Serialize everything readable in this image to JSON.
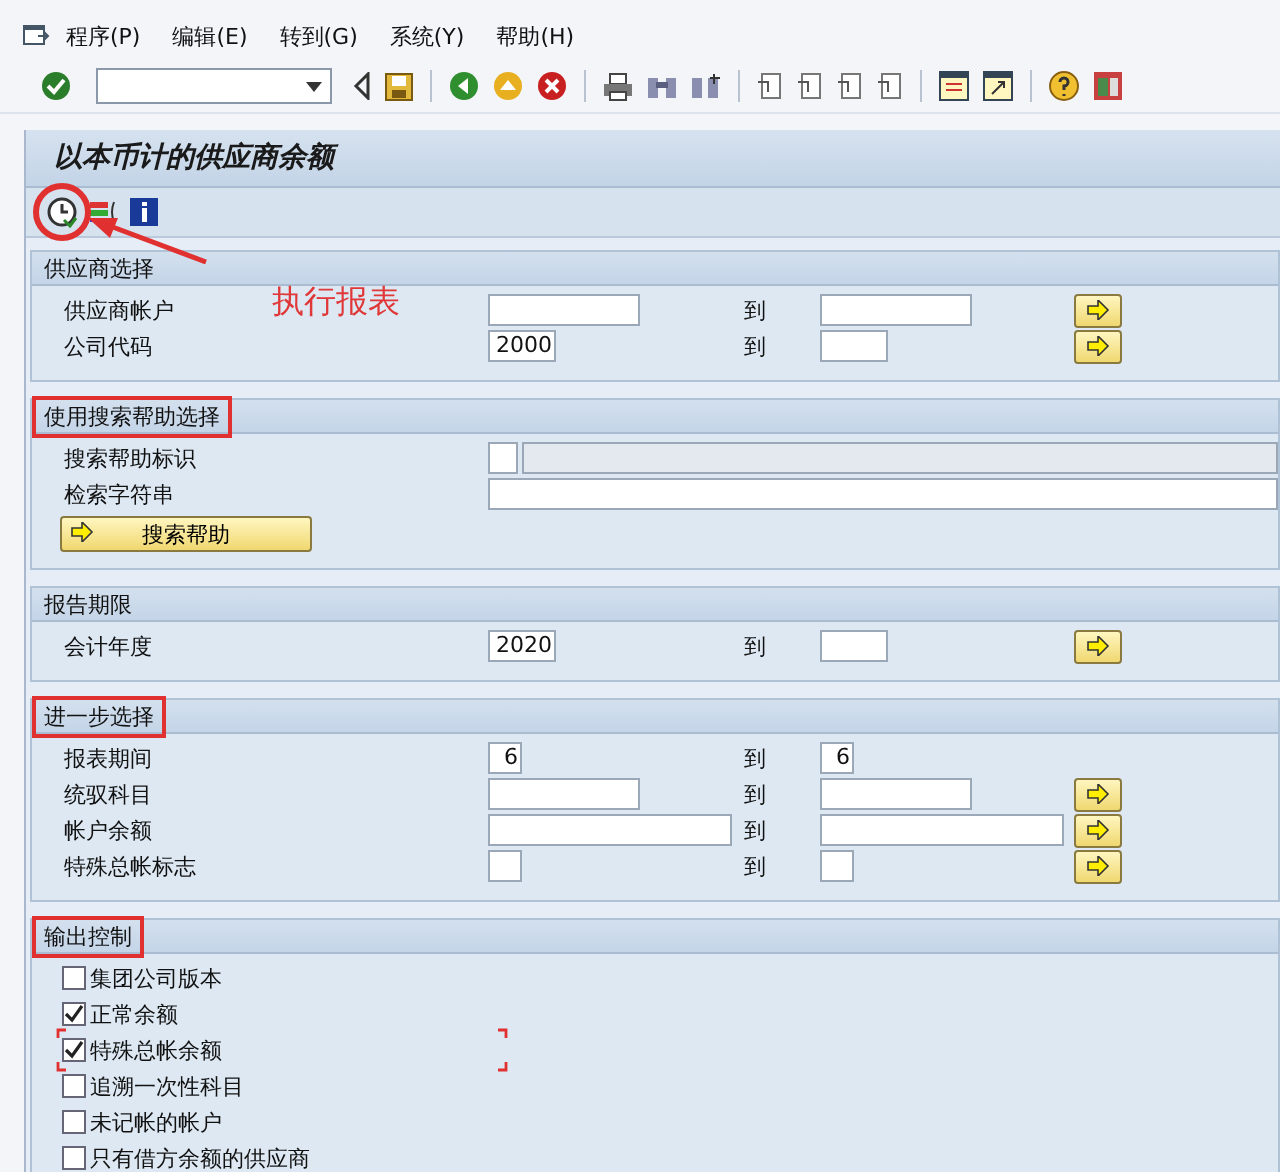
{
  "menu": [
    {
      "label": "程序(P)"
    },
    {
      "label": "编辑(E)"
    },
    {
      "label": "转到(G)"
    },
    {
      "label": "系统(Y)"
    },
    {
      "label": "帮助(H)"
    }
  ],
  "title": "以本币计的供应商余额",
  "annotation": {
    "text": "执行报表"
  },
  "sections": [
    {
      "title": "供应商选择",
      "highlighted": false,
      "rows": [
        {
          "kind": "range",
          "label": "供应商帐户",
          "low": {
            "kind": "short"
          },
          "to": "到",
          "high": {
            "kind": "short"
          },
          "more": true
        },
        {
          "kind": "range",
          "label": "公司代码",
          "low": {
            "value": "2000",
            "kind": "tiny"
          },
          "to": "到",
          "high": {
            "kind": "tiny"
          },
          "more": true
        }
      ]
    },
    {
      "title": "使用搜索帮助选择",
      "highlighted": true,
      "rows": [
        {
          "kind": "helpid",
          "label": "搜索帮助标识"
        },
        {
          "kind": "text",
          "label": "检索字符串"
        }
      ],
      "button": "搜索帮助"
    },
    {
      "title": "报告期限",
      "highlighted": false,
      "rows": [
        {
          "kind": "range",
          "label": "会计年度",
          "low": {
            "value": "2020",
            "kind": "tiny"
          },
          "to": "到",
          "high": {
            "kind": "tiny"
          },
          "more": true
        }
      ]
    },
    {
      "title": "进一步选择",
      "highlighted": true,
      "rows": [
        {
          "kind": "range",
          "label": "报表期间",
          "low": {
            "value": "6",
            "kind": "xs"
          },
          "to": "到",
          "high": {
            "value": "6",
            "kind": "xs"
          },
          "more": false
        },
        {
          "kind": "range",
          "label": "统驭科目",
          "low": {
            "kind": "short"
          },
          "to": "到",
          "high": {
            "kind": "short"
          },
          "more": true
        },
        {
          "kind": "range",
          "label": "帐户余额",
          "low": {
            "kind": "medium"
          },
          "to": "到",
          "high": {
            "kind": "medium"
          },
          "more": true
        },
        {
          "kind": "range",
          "label": "特殊总帐标志",
          "low": {
            "kind": "xs"
          },
          "to": "到",
          "high": {
            "kind": "xs"
          },
          "more": true
        }
      ]
    },
    {
      "title": "输出控制",
      "highlighted": true,
      "checks": [
        {
          "label": "集团公司版本",
          "checked": false,
          "marked": false
        },
        {
          "label": "正常余额",
          "checked": true,
          "marked": false
        },
        {
          "label": "特殊总帐余额",
          "checked": true,
          "marked": true
        },
        {
          "label": "追溯一次性科目",
          "checked": false,
          "marked": false
        },
        {
          "label": "未记帐的帐户",
          "checked": false,
          "marked": false
        },
        {
          "label": "只有借方余额的供应商",
          "checked": false,
          "marked": false
        }
      ]
    }
  ]
}
